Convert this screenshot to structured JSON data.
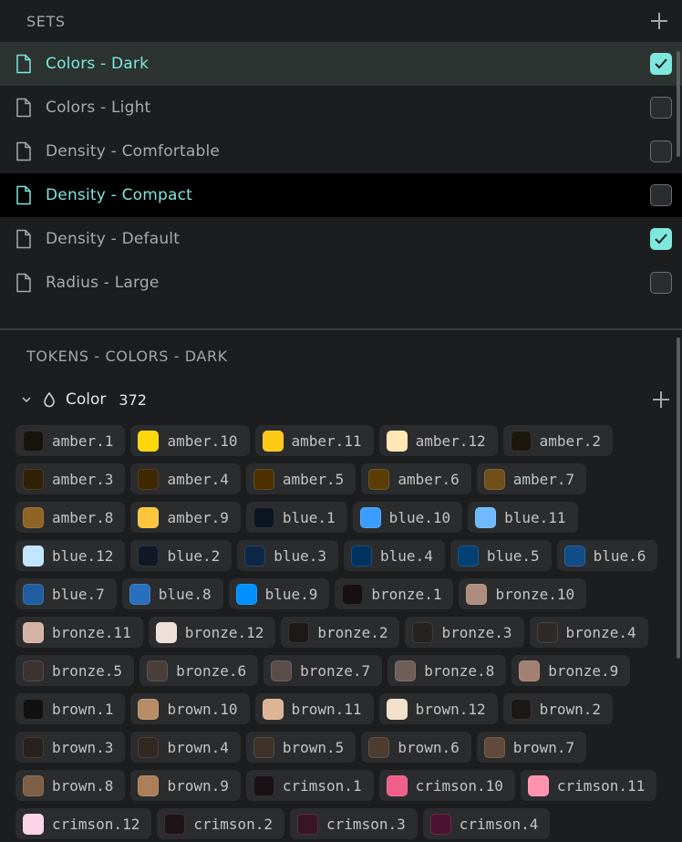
{
  "sets": {
    "title": "SETS",
    "items": [
      {
        "label": "Colors - Dark",
        "checked": true,
        "state": "active"
      },
      {
        "label": "Colors - Light",
        "checked": false,
        "state": ""
      },
      {
        "label": "Density - Comfortable",
        "checked": false,
        "state": ""
      },
      {
        "label": "Density - Compact",
        "checked": false,
        "state": "hover"
      },
      {
        "label": "Density - Default",
        "checked": true,
        "state": ""
      },
      {
        "label": "Radius - Large",
        "checked": false,
        "state": ""
      }
    ]
  },
  "tokens": {
    "title": "TOKENS - COLORS - DARK",
    "group": {
      "label": "Color",
      "count": "372"
    },
    "items": [
      {
        "label": "amber.1",
        "color": "#16120c"
      },
      {
        "label": "amber.10",
        "color": "#ffd60a"
      },
      {
        "label": "amber.11",
        "color": "#ffca16"
      },
      {
        "label": "amber.12",
        "color": "#ffe7b3"
      },
      {
        "label": "amber.2",
        "color": "#1d180f"
      },
      {
        "label": "amber.3",
        "color": "#302008"
      },
      {
        "label": "amber.4",
        "color": "#3f2700"
      },
      {
        "label": "amber.5",
        "color": "#4d3000"
      },
      {
        "label": "amber.6",
        "color": "#5c3d05"
      },
      {
        "label": "amber.7",
        "color": "#714f19"
      },
      {
        "label": "amber.8",
        "color": "#8f6424"
      },
      {
        "label": "amber.9",
        "color": "#ffc53d"
      },
      {
        "label": "blue.1",
        "color": "#0d1520"
      },
      {
        "label": "blue.10",
        "color": "#3b9eff"
      },
      {
        "label": "blue.11",
        "color": "#70b8ff"
      },
      {
        "label": "blue.12",
        "color": "#c2e6ff"
      },
      {
        "label": "blue.2",
        "color": "#111927"
      },
      {
        "label": "blue.3",
        "color": "#0d2847"
      },
      {
        "label": "blue.4",
        "color": "#003362"
      },
      {
        "label": "blue.5",
        "color": "#004074"
      },
      {
        "label": "blue.6",
        "color": "#104d87"
      },
      {
        "label": "blue.7",
        "color": "#205d9e"
      },
      {
        "label": "blue.8",
        "color": "#2870bd"
      },
      {
        "label": "blue.9",
        "color": "#0090ff"
      },
      {
        "label": "bronze.1",
        "color": "#141110"
      },
      {
        "label": "bronze.10",
        "color": "#ae8c7e"
      },
      {
        "label": "bronze.11",
        "color": "#d4b3a5"
      },
      {
        "label": "bronze.12",
        "color": "#ede0d9"
      },
      {
        "label": "bronze.2",
        "color": "#1c1917"
      },
      {
        "label": "bronze.3",
        "color": "#262220"
      },
      {
        "label": "bronze.4",
        "color": "#302a27"
      },
      {
        "label": "bronze.5",
        "color": "#3b3330"
      },
      {
        "label": "bronze.6",
        "color": "#493e3a"
      },
      {
        "label": "bronze.7",
        "color": "#5a4c47"
      },
      {
        "label": "bronze.8",
        "color": "#6f5f58"
      },
      {
        "label": "bronze.9",
        "color": "#a18072"
      },
      {
        "label": "brown.1",
        "color": "#12110f"
      },
      {
        "label": "brown.10",
        "color": "#b88c67"
      },
      {
        "label": "brown.11",
        "color": "#dbb594"
      },
      {
        "label": "brown.12",
        "color": "#f2e1ca"
      },
      {
        "label": "brown.2",
        "color": "#1c1816"
      },
      {
        "label": "brown.3",
        "color": "#28211d"
      },
      {
        "label": "brown.4",
        "color": "#322922"
      },
      {
        "label": "brown.5",
        "color": "#3e3128"
      },
      {
        "label": "brown.6",
        "color": "#4d3c2f"
      },
      {
        "label": "brown.7",
        "color": "#614a39"
      },
      {
        "label": "brown.8",
        "color": "#7c5f46"
      },
      {
        "label": "brown.9",
        "color": "#ad7f58"
      },
      {
        "label": "crimson.1",
        "color": "#191114"
      },
      {
        "label": "crimson.10",
        "color": "#ef5f8a"
      },
      {
        "label": "crimson.11",
        "color": "#ff92ad"
      },
      {
        "label": "crimson.12",
        "color": "#fdd3e8"
      },
      {
        "label": "crimson.2",
        "color": "#201318"
      },
      {
        "label": "crimson.3",
        "color": "#381525"
      },
      {
        "label": "crimson.4",
        "color": "#4d122f"
      }
    ]
  }
}
